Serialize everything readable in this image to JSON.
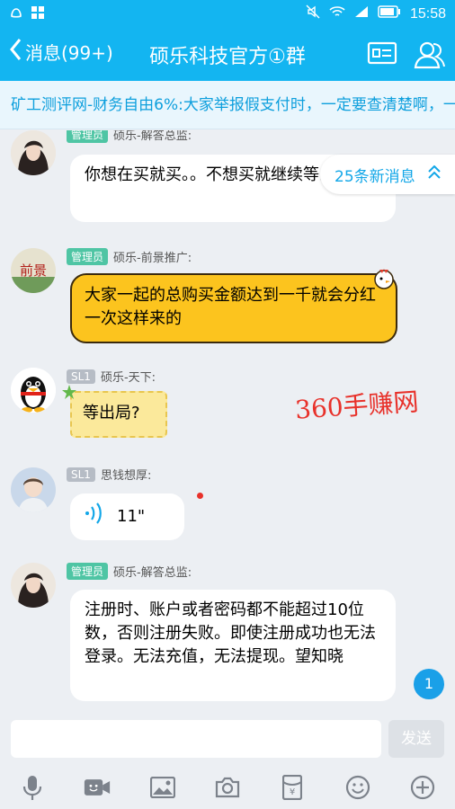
{
  "status": {
    "time": "15:58"
  },
  "header": {
    "back_label": "消息(99+)",
    "title": "硕乐科技官方①群"
  },
  "notice": {
    "text": "矿工测评网-财务自由6%:大家举报假支付时，一定要查清楚啊，一"
  },
  "new_messages": {
    "label": "25条新消息"
  },
  "messages": [
    {
      "role": "管理员",
      "sender": "硕乐-解答总监:",
      "text": "你想在买就买。。不想买就继续等出局。"
    },
    {
      "role": "管理员",
      "sender": "硕乐-前景推广:",
      "text": "大家一起的总购买金额达到一千就会分红一次这样来的"
    },
    {
      "role": "SL1",
      "sender": "硕乐-天下:",
      "text": "等出局?"
    },
    {
      "role": "SL1",
      "sender": "思钱想厚:",
      "text": "11\""
    },
    {
      "role": "管理员",
      "sender": "硕乐-解答总监:",
      "text": "注册时、账户或者密码都不能超过10位数，否则注册失败。即使注册成功也无法登录。无法充值，无法提现。望知晓"
    }
  ],
  "avatar_text": {
    "m2": "前景"
  },
  "watermark": "360手赚网",
  "unread_count": "1",
  "composer": {
    "send_label": "发送"
  },
  "colors": {
    "primary": "#13b5f1",
    "link": "#0d9fdd",
    "admin_badge": "#4fc5a4"
  }
}
